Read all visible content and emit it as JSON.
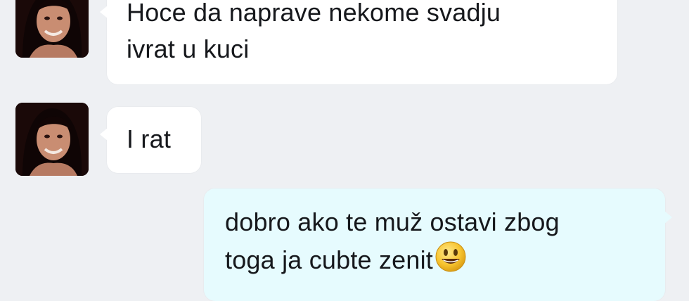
{
  "conversation": {
    "messages": [
      {
        "direction": "incoming",
        "text": "Hoce da naprave nekome svadju\nivrat u kuci",
        "avatar_icon": "contact-avatar"
      },
      {
        "direction": "incoming",
        "text": "I rat",
        "avatar_icon": "contact-avatar"
      },
      {
        "direction": "outgoing",
        "text": "dobro ako te muž ostavi zbog\ntoga ja cubte zenit",
        "emoji": "smiling-face-emoji"
      }
    ]
  },
  "colors": {
    "background": "#eef0f3",
    "incoming_bubble": "#ffffff",
    "outgoing_bubble": "#e6fbfe",
    "text": "#16181c",
    "emoji_yellow": "#f7c531"
  }
}
